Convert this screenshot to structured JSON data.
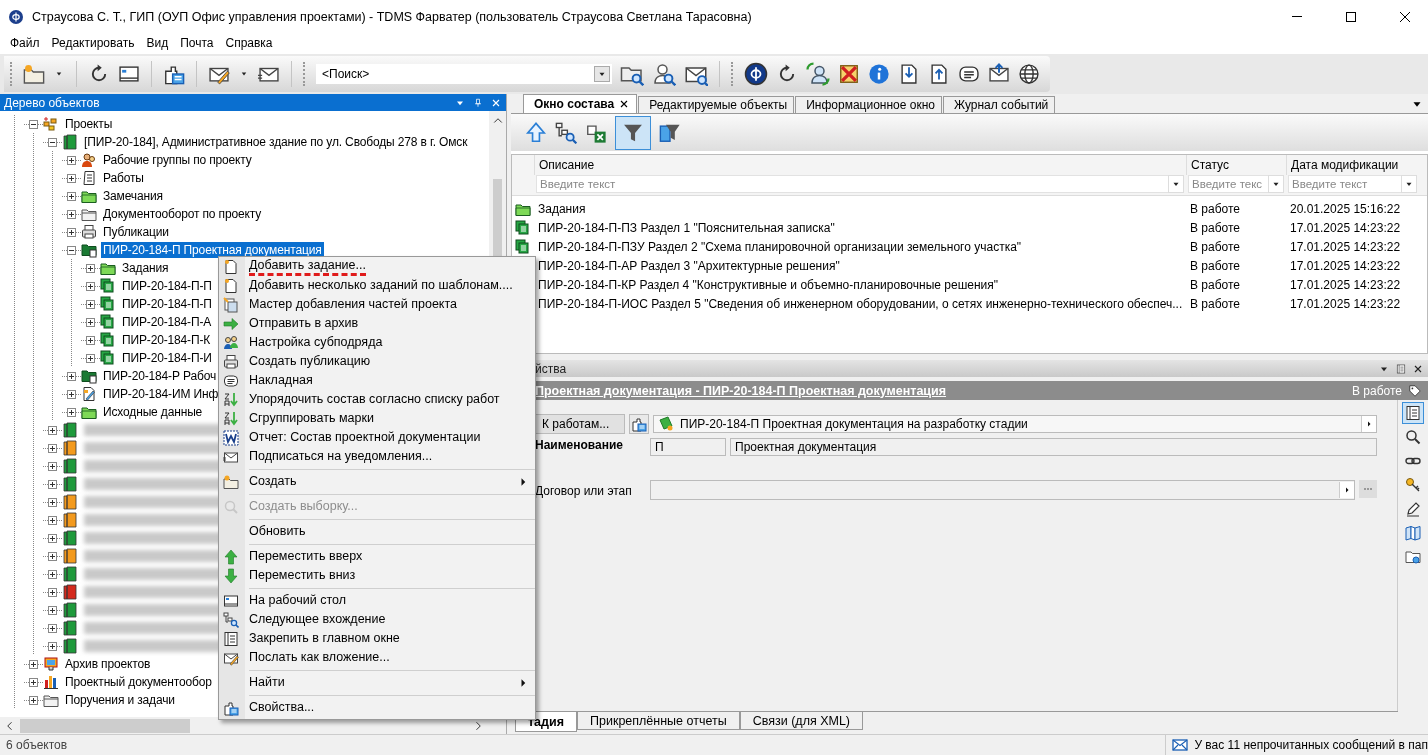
{
  "window": {
    "title": "Страусова С. Т., ГИП (ОУП Офис управления проектами) - TDMS Фарватер (пользователь Страусова Светлана Тарасовна)"
  },
  "menu_bar": [
    "Файл",
    "Редактировать",
    "Вид",
    "Почта",
    "Справка"
  ],
  "toolbar": {
    "search": {
      "value": "<Поиск>"
    }
  },
  "object_tree": {
    "title": "Дерево объектов",
    "items": [
      {
        "kind": "projects",
        "label": "Проекты",
        "expanded": true,
        "selected": false,
        "children": [
          {
            "kind": "project",
            "label": "[ПИР-20-184], Административное здание по ул. Свободы 278 в г. Омск",
            "color": "#1f9a3c",
            "expanded": true,
            "selected": false,
            "children": [
              {
                "kind": "workgroups",
                "label": "Рабочие группы по проекту",
                "expanded": false,
                "selected": false
              },
              {
                "kind": "works",
                "label": "Работы",
                "expanded": false,
                "selected": false
              },
              {
                "kind": "folder",
                "label": "Замечания",
                "expanded": false,
                "selected": false
              },
              {
                "kind": "docflow",
                "label": "Документооборот по проекту",
                "expanded": false,
                "selected": false
              },
              {
                "kind": "publications",
                "label": "Публикации",
                "expanded": false,
                "selected": false
              },
              {
                "kind": "stage",
                "label": "ПИР-20-184-П Проектная документация",
                "expanded": true,
                "selected": true,
                "children": [
                  {
                    "kind": "folder",
                    "label": "Задания",
                    "expanded": false,
                    "selected": false
                  },
                  {
                    "kind": "section",
                    "label": "ПИР-20-184-П-П",
                    "expanded": false,
                    "selected": false
                  },
                  {
                    "kind": "section",
                    "label": "ПИР-20-184-П-П",
                    "expanded": false,
                    "selected": false
                  },
                  {
                    "kind": "section",
                    "label": "ПИР-20-184-П-А",
                    "expanded": false,
                    "selected": false
                  },
                  {
                    "kind": "section",
                    "label": "ПИР-20-184-П-К",
                    "expanded": false,
                    "selected": false
                  },
                  {
                    "kind": "section",
                    "label": "ПИР-20-184-П-И",
                    "expanded": false,
                    "selected": false
                  }
                ]
              },
              {
                "kind": "stage",
                "label": "ПИР-20-184-Р Рабоч",
                "expanded": false,
                "selected": false
              },
              {
                "kind": "infomodel",
                "label": "ПИР-20-184-ИМ Инф",
                "expanded": false,
                "selected": false
              },
              {
                "kind": "folder",
                "label": "Исходные данные",
                "expanded": false,
                "selected": false
              }
            ]
          },
          {
            "kind": "project",
            "redacted": true,
            "color": "#1f9a3c",
            "expanded": false,
            "selected": false
          },
          {
            "kind": "project",
            "redacted": true,
            "color": "#f39a1e",
            "expanded": false,
            "selected": false
          },
          {
            "kind": "project",
            "redacted": true,
            "color": "#1f9a3c",
            "expanded": false,
            "selected": false
          },
          {
            "kind": "project",
            "redacted": true,
            "color": "#1f9a3c",
            "expanded": false,
            "selected": false
          },
          {
            "kind": "project",
            "redacted": true,
            "color": "#f39a1e",
            "expanded": false,
            "selected": false
          },
          {
            "kind": "project",
            "redacted": true,
            "color": "#f39a1e",
            "expanded": false,
            "selected": false
          },
          {
            "kind": "project",
            "redacted": true,
            "color": "#1f9a3c",
            "expanded": false,
            "selected": false
          },
          {
            "kind": "project",
            "redacted": true,
            "color": "#f39a1e",
            "expanded": false,
            "selected": false
          },
          {
            "kind": "project",
            "redacted": true,
            "color": "#1f9a3c",
            "expanded": false,
            "selected": false
          },
          {
            "kind": "project",
            "redacted": true,
            "color": "#d42a1e",
            "expanded": false,
            "selected": false
          },
          {
            "kind": "project",
            "redacted": true,
            "color": "#1f9a3c",
            "expanded": false,
            "selected": false
          },
          {
            "kind": "project",
            "redacted": true,
            "color": "#1f9a3c",
            "expanded": false,
            "selected": false
          },
          {
            "kind": "project",
            "redacted": true,
            "color": "#1f9a3c",
            "expanded": false,
            "selected": false
          }
        ]
      },
      {
        "kind": "archive",
        "label": "Архив проектов",
        "expanded": false,
        "selected": false
      },
      {
        "kind": "chart",
        "label": "Проектный документообор",
        "expanded": false,
        "selected": false
      },
      {
        "kind": "tasks",
        "label": "Поручения и задачи",
        "expanded": false,
        "selected": false
      }
    ]
  },
  "context_menu": {
    "items": [
      {
        "kind": "item",
        "label": "Добавить задание...",
        "marked": true,
        "disabled": false,
        "submenu": false
      },
      {
        "kind": "item",
        "label": "Добавить несколько заданий по шаблонам....",
        "marked": false,
        "disabled": false,
        "submenu": false
      },
      {
        "kind": "item",
        "label": "Мастер добавления частей проекта",
        "marked": false,
        "disabled": false,
        "submenu": false
      },
      {
        "kind": "item",
        "label": "Отправить в архив",
        "marked": false,
        "disabled": false,
        "submenu": false
      },
      {
        "kind": "item",
        "label": "Настройка субподряда",
        "marked": false,
        "disabled": false,
        "submenu": false
      },
      {
        "kind": "item",
        "label": "Создать публикацию",
        "marked": false,
        "disabled": false,
        "submenu": false
      },
      {
        "kind": "item",
        "label": "Накладная",
        "marked": false,
        "disabled": false,
        "submenu": false
      },
      {
        "kind": "item",
        "label": "Упорядочить состав согласно списку работ",
        "marked": false,
        "disabled": false,
        "submenu": false
      },
      {
        "kind": "item",
        "label": "Сгруппировать марки",
        "marked": false,
        "disabled": false,
        "submenu": false
      },
      {
        "kind": "item",
        "label": "Отчет: Состав проектной документации",
        "marked": false,
        "disabled": false,
        "submenu": false
      },
      {
        "kind": "item",
        "label": "Подписаться на уведомления...",
        "marked": false,
        "disabled": false,
        "submenu": false
      },
      {
        "kind": "separator"
      },
      {
        "kind": "item",
        "label": "Создать",
        "marked": false,
        "disabled": false,
        "submenu": true
      },
      {
        "kind": "separator"
      },
      {
        "kind": "item",
        "label": "Создать выборку...",
        "marked": false,
        "disabled": true,
        "submenu": false
      },
      {
        "kind": "separator"
      },
      {
        "kind": "item",
        "label": "Обновить",
        "marked": false,
        "disabled": false,
        "submenu": false
      },
      {
        "kind": "separator"
      },
      {
        "kind": "item",
        "label": "Переместить вверх",
        "marked": false,
        "disabled": false,
        "submenu": false
      },
      {
        "kind": "item",
        "label": "Переместить вниз",
        "marked": false,
        "disabled": false,
        "submenu": false
      },
      {
        "kind": "separator"
      },
      {
        "kind": "item",
        "label": "На рабочий стол",
        "marked": false,
        "disabled": false,
        "submenu": false
      },
      {
        "kind": "item",
        "label": "Следующее вхождение",
        "marked": false,
        "disabled": false,
        "submenu": false
      },
      {
        "kind": "item",
        "label": "Закрепить в главном окне",
        "marked": false,
        "disabled": false,
        "submenu": false
      },
      {
        "kind": "item",
        "label": "Послать как вложение...",
        "marked": false,
        "disabled": false,
        "submenu": false
      },
      {
        "kind": "separator"
      },
      {
        "kind": "item",
        "label": "Найти",
        "marked": false,
        "disabled": false,
        "submenu": true
      },
      {
        "kind": "separator"
      },
      {
        "kind": "item",
        "label": "Свойства...",
        "marked": false,
        "disabled": false,
        "submenu": false
      }
    ]
  },
  "composition": {
    "tabs": [
      {
        "label": "Окно состава",
        "selected": true,
        "closable": true
      },
      {
        "label": "Редактируемые объекты",
        "selected": false,
        "closable": false
      },
      {
        "label": "Информационное окно",
        "selected": false,
        "closable": false
      },
      {
        "label": "Журнал событий",
        "selected": false,
        "closable": false
      }
    ],
    "tools": [
      {
        "selected": false
      },
      {
        "selected": false
      },
      {
        "selected": false
      },
      {
        "selected": true
      },
      {
        "selected": false
      }
    ],
    "columns": [
      {
        "label": "Описание",
        "placeholder": "Введите текст"
      },
      {
        "label": "Статус",
        "placeholder": "Введите текс"
      },
      {
        "label": "Дата модификации",
        "placeholder": "Введите текст"
      }
    ],
    "rows": [
      {
        "kind": "folder",
        "cells": [
          "Задания",
          "В работе",
          "20.01.2025 15:16:22"
        ]
      },
      {
        "kind": "section",
        "cells": [
          "ПИР-20-184-П-ПЗ Раздел 1 \"Пояснительная записка\"",
          "В работе",
          "17.01.2025 14:23:22"
        ]
      },
      {
        "kind": "section",
        "cells": [
          "ПИР-20-184-П-ПЗУ Раздел 2 \"Схема планировочной организации земельного участка\"",
          "В работе",
          "17.01.2025 14:23:22"
        ]
      },
      {
        "kind": "section",
        "cells": [
          "ПИР-20-184-П-АР Раздел 3 \"Архитектурные решения\"",
          "В работе",
          "17.01.2025 14:23:22"
        ]
      },
      {
        "kind": "section",
        "cells": [
          "ПИР-20-184-П-КР Раздел 4 \"Конструктивные и объемно-планировочные решения\"",
          "В работе",
          "17.01.2025 14:23:22"
        ]
      },
      {
        "kind": "section",
        "cells": [
          "ПИР-20-184-П-ИОС Раздел 5 \"Сведения об инженерном оборудовании, о сетях инженерно-технического обеспеч...",
          "В работе",
          "17.01.2025 14:23:22"
        ]
      }
    ]
  },
  "properties": {
    "title": "йства",
    "object_title": "Проектная документация - ПИР-20-184-П Проектная документация",
    "status": "В работе",
    "parent_button": "К работам...",
    "parent_value": "ПИР-20-184-П Проектная документация на разработку стадии",
    "name_label": "Наименование",
    "name_code": "П",
    "name_value": "Проектная документация",
    "contract_label": "Договор или этап",
    "side_tools": [
      {
        "selected": true
      },
      {
        "selected": false
      },
      {
        "selected": false
      },
      {
        "selected": false
      },
      {
        "selected": false
      },
      {
        "selected": false
      },
      {
        "selected": false
      }
    ],
    "tabs": [
      {
        "label": "тадия",
        "selected": true
      },
      {
        "label": "Прикреплённые отчеты",
        "selected": false
      },
      {
        "label": "Связи (для XML)",
        "selected": false
      }
    ]
  },
  "status_bar": {
    "count": "6 объектов",
    "message": "У вас 11 непрочитанных сообщений в пап"
  }
}
